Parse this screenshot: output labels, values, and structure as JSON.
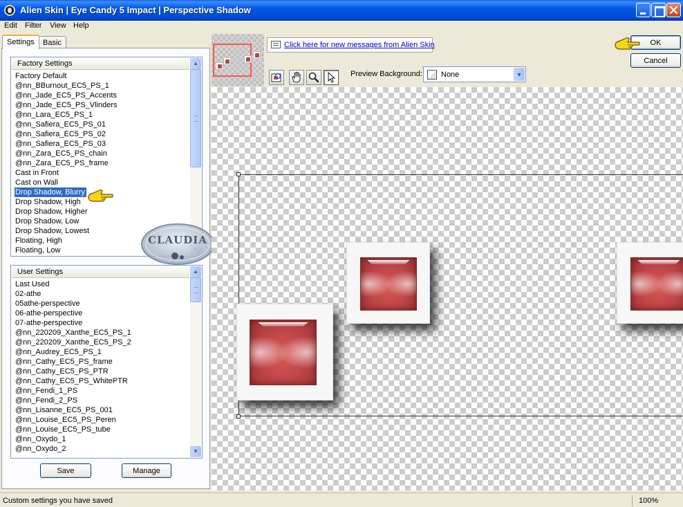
{
  "window": {
    "title": "Alien Skin | Eye Candy 5 Impact | Perspective Shadow"
  },
  "menu": [
    "Edit",
    "Filter",
    "View",
    "Help"
  ],
  "tabs": {
    "settings": "Settings",
    "basic": "Basic"
  },
  "factory_settings": {
    "header": "Factory Settings",
    "items": [
      "Factory Default",
      "@nn_BBurnout_EC5_PS_1",
      "@nn_Jade_EC5_PS_Accents",
      "@nn_Jade_EC5_PS_Vlinders",
      "@nn_Lara_EC5_PS_1",
      "@nn_Safiera_EC5_PS_01",
      "@nn_Safiera_EC5_PS_02",
      "@nn_Safiera_EC5_PS_03",
      "@nn_Zara_EC5_PS_chain",
      "@nn_Zara_EC5_PS_frame",
      "Cast in Front",
      "Cast on Wall",
      "Drop Shadow, Blurry",
      "Drop Shadow, High",
      "Drop Shadow, Higher",
      "Drop Shadow, Low",
      "Drop Shadow, Lowest",
      "Floating, High",
      "Floating, Low"
    ],
    "selected_index": 12
  },
  "user_settings": {
    "header": "User Settings",
    "items": [
      "Last Used",
      "02-athe",
      "05athe-perspective",
      "06-athe-perspective",
      "07-athe-perspective",
      "@nn_220209_Xanthe_EC5_PS_1",
      "@nn_220209_Xanthe_EC5_PS_2",
      "@nn_Audrey_EC5_PS_1",
      "@nn_Cathy_EC5_PS_frame",
      "@nn_Cathy_EC5_PS_PTR",
      "@nn_Cathy_EC5_PS_WhitePTR",
      "@nn_Fendi_1_PS",
      "@nn_Fendi_2_PS",
      "@nn_Lisanne_EC5_PS_001",
      "@nn_Louise_EC5_PS_Peren",
      "@nn_Louise_EC5_PS_tube",
      "@nn_Oxydo_1",
      "@nn_Oxydo_2"
    ]
  },
  "buttons": {
    "save": "Save",
    "manage": "Manage",
    "ok": "OK",
    "cancel": "Cancel"
  },
  "messages": {
    "link": "Click here for new messages from Alien Skin"
  },
  "toolbar": {
    "tools": [
      "navigate-icon",
      "hand-pan-icon",
      "zoom-icon",
      "pointer-arrow-icon"
    ],
    "active_tool": "pointer-arrow-icon"
  },
  "preview_background": {
    "label": "Preview Background:",
    "value": "None"
  },
  "status": {
    "text": "Custom settings you have saved",
    "zoom": "100%"
  },
  "watermark": {
    "text": "CLAUDIA"
  },
  "colors": {
    "titlebar": "#0054e3",
    "selection": "#316ac5",
    "tile_red": "#c2474a",
    "nav_frame": "#ff5252",
    "link": "#0000c0"
  }
}
